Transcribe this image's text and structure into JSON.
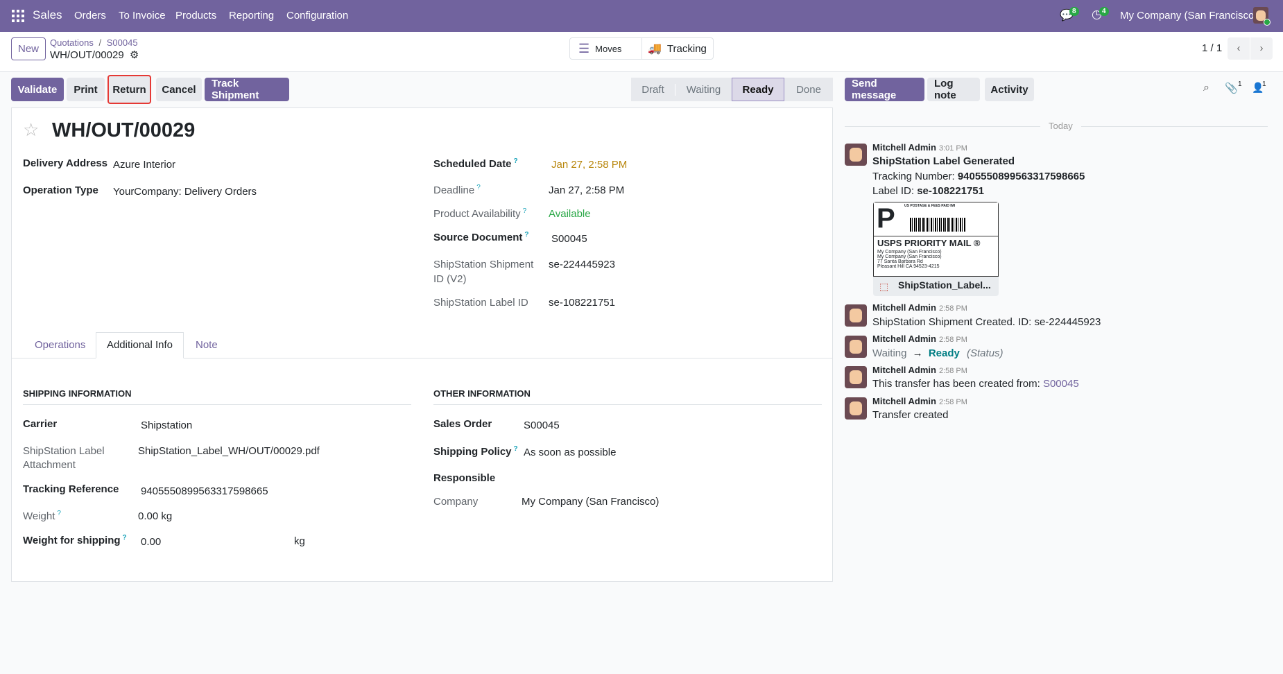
{
  "navbar": {
    "app": "Sales",
    "menu": [
      "Orders",
      "To Invoice",
      "Products",
      "Reporting",
      "Configuration"
    ],
    "messages_count": "8",
    "activities_count": "4",
    "company": "My Company (San Francisco)"
  },
  "control": {
    "new_label": "New",
    "breadcrumb_parent": "Quotations",
    "breadcrumb_sep": "/",
    "breadcrumb_order": "S00045",
    "record": "WH/OUT/00029",
    "smart_moves": "Moves",
    "smart_tracking": "Tracking",
    "pager": "1 / 1"
  },
  "actions": {
    "validate": "Validate",
    "print": "Print",
    "return": "Return",
    "cancel": "Cancel",
    "track": "Track Shipment"
  },
  "status": {
    "steps": [
      "Draft",
      "Waiting",
      "Ready",
      "Done"
    ],
    "current": "Ready"
  },
  "form": {
    "title": "WH/OUT/00029",
    "left": [
      {
        "label": "Delivery Address",
        "value": "Azure Interior"
      },
      {
        "label": "Operation Type",
        "value": "YourCompany: Delivery Orders"
      }
    ],
    "right": {
      "scheduled_label": "Scheduled Date",
      "scheduled": "Jan 27, 2:58 PM",
      "deadline_label": "Deadline",
      "deadline": "Jan 27, 2:58 PM",
      "avail_label": "Product Availability",
      "avail": "Available",
      "source_label": "Source Document",
      "source": "S00045",
      "shipment_label_1": "ShipStation Shipment",
      "shipment_label_2": "ID (V2)",
      "shipment": "se-224445923",
      "labelid_label": "ShipStation Label ID",
      "labelid": "se-108221751"
    },
    "help": "?",
    "tabs": [
      "Operations",
      "Additional Info",
      "Note"
    ],
    "shipping": {
      "heading": "SHIPPING INFORMATION",
      "carrier_label": "Carrier",
      "carrier": "Shipstation",
      "attach_label_1": "ShipStation Label",
      "attach_label_2": "Attachment",
      "attach": "ShipStation_Label_WH/OUT/00029.pdf",
      "tracking_label": "Tracking Reference",
      "tracking": "9405550899563317598665",
      "weight_label": "Weight",
      "weight": "0.00 kg",
      "wship_label": "Weight for shipping",
      "wship": "0.00",
      "wship_unit": "kg"
    },
    "other": {
      "heading": "OTHER INFORMATION",
      "so_label": "Sales Order",
      "so": "S00045",
      "policy_label": "Shipping Policy",
      "policy": "As soon as possible",
      "resp_label": "Responsible",
      "company_label": "Company",
      "company": "My Company (San Francisco)"
    }
  },
  "chatter": {
    "send": "Send message",
    "log": "Log note",
    "activity": "Activity",
    "attach_count": "1",
    "follower_count": "1",
    "today": "Today",
    "messages": [
      {
        "author": "Mitchell Admin",
        "time": "3:01 PM",
        "title": "ShipStation Label Generated",
        "tracking_prefix": "Tracking Number: ",
        "tracking": "9405550899563317598665",
        "label_prefix": "Label ID: ",
        "label": "se-108221751",
        "attachment": "ShipStation_Label...",
        "label_p": "P",
        "label_service": "USPS PRIORITY MAIL ®",
        "label_postage": "US POSTAGE & FEES PAID IMI",
        "label_addr": [
          "My Company (San Francisco)",
          "My Company (San Francisco)",
          "77 Santa Barbara Rd",
          "Pleasant Hill CA 94523-4215"
        ]
      },
      {
        "author": "Mitchell Admin",
        "time": "2:58 PM",
        "text": "ShipStation Shipment Created. ID: se-224445923"
      },
      {
        "author": "Mitchell Admin",
        "time": "2:58 PM",
        "from": "Waiting",
        "arrow": "→",
        "to": "Ready",
        "field": "(Status)"
      },
      {
        "author": "Mitchell Admin",
        "time": "2:58 PM",
        "text": "This transfer has been created from: ",
        "link": "S00045"
      },
      {
        "author": "Mitchell Admin",
        "time": "2:58 PM",
        "text": "Transfer created"
      }
    ]
  }
}
